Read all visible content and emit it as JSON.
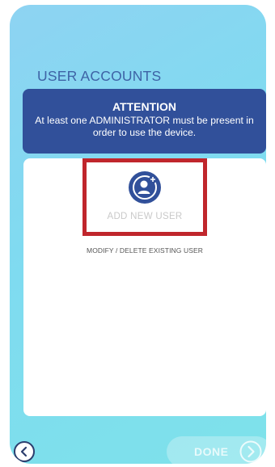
{
  "title": "USER ACCOUNTS",
  "attention": {
    "title": "ATTENTION",
    "message": "At least one ADMINISTRATOR must be present in order to use the device."
  },
  "add_user": {
    "icon": "add-user-icon",
    "label": "ADD NEW USER"
  },
  "modify_link": "MODIFY / DELETE EXISTING USER",
  "footer": {
    "back_icon": "chevron-left-icon",
    "done_label": "DONE",
    "done_icon": "chevron-right-icon"
  },
  "colors": {
    "accent": "#31509a",
    "highlight": "#c0262c",
    "title": "#3e63a6"
  }
}
